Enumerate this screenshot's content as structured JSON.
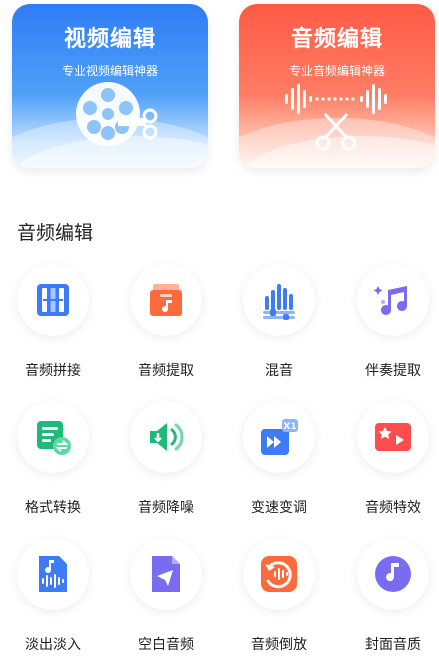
{
  "video_card": {
    "title": "视频编辑",
    "subtitle": "专业视频编辑神器"
  },
  "audio_card": {
    "title": "音频编辑",
    "subtitle": "专业音频编辑神器"
  },
  "section_title": "音频编辑",
  "tools": [
    {
      "label": "音频拼接",
      "icon": "splice-icon"
    },
    {
      "label": "音频提取",
      "icon": "extract-icon"
    },
    {
      "label": "混音",
      "icon": "mix-icon"
    },
    {
      "label": "伴奏提取",
      "icon": "accompaniment-icon"
    },
    {
      "label": "格式转换",
      "icon": "format-convert-icon"
    },
    {
      "label": "音频降噪",
      "icon": "denoise-icon"
    },
    {
      "label": "变速变调",
      "icon": "speed-pitch-icon"
    },
    {
      "label": "音频特效",
      "icon": "effects-icon"
    },
    {
      "label": "淡出淡入",
      "icon": "fade-icon"
    },
    {
      "label": "空白音频",
      "icon": "blank-audio-icon"
    },
    {
      "label": "音频倒放",
      "icon": "reverse-icon"
    },
    {
      "label": "封面音质",
      "icon": "cover-quality-icon"
    }
  ],
  "speed_badge": "X1",
  "colors": {
    "video": "#2f7cf6",
    "audio": "#ff5a47",
    "blue": "#3d7bf7",
    "orange": "#ff6a3d",
    "green": "#1fb97a",
    "purple": "#7a6cf0",
    "red": "#ff4d4d"
  }
}
